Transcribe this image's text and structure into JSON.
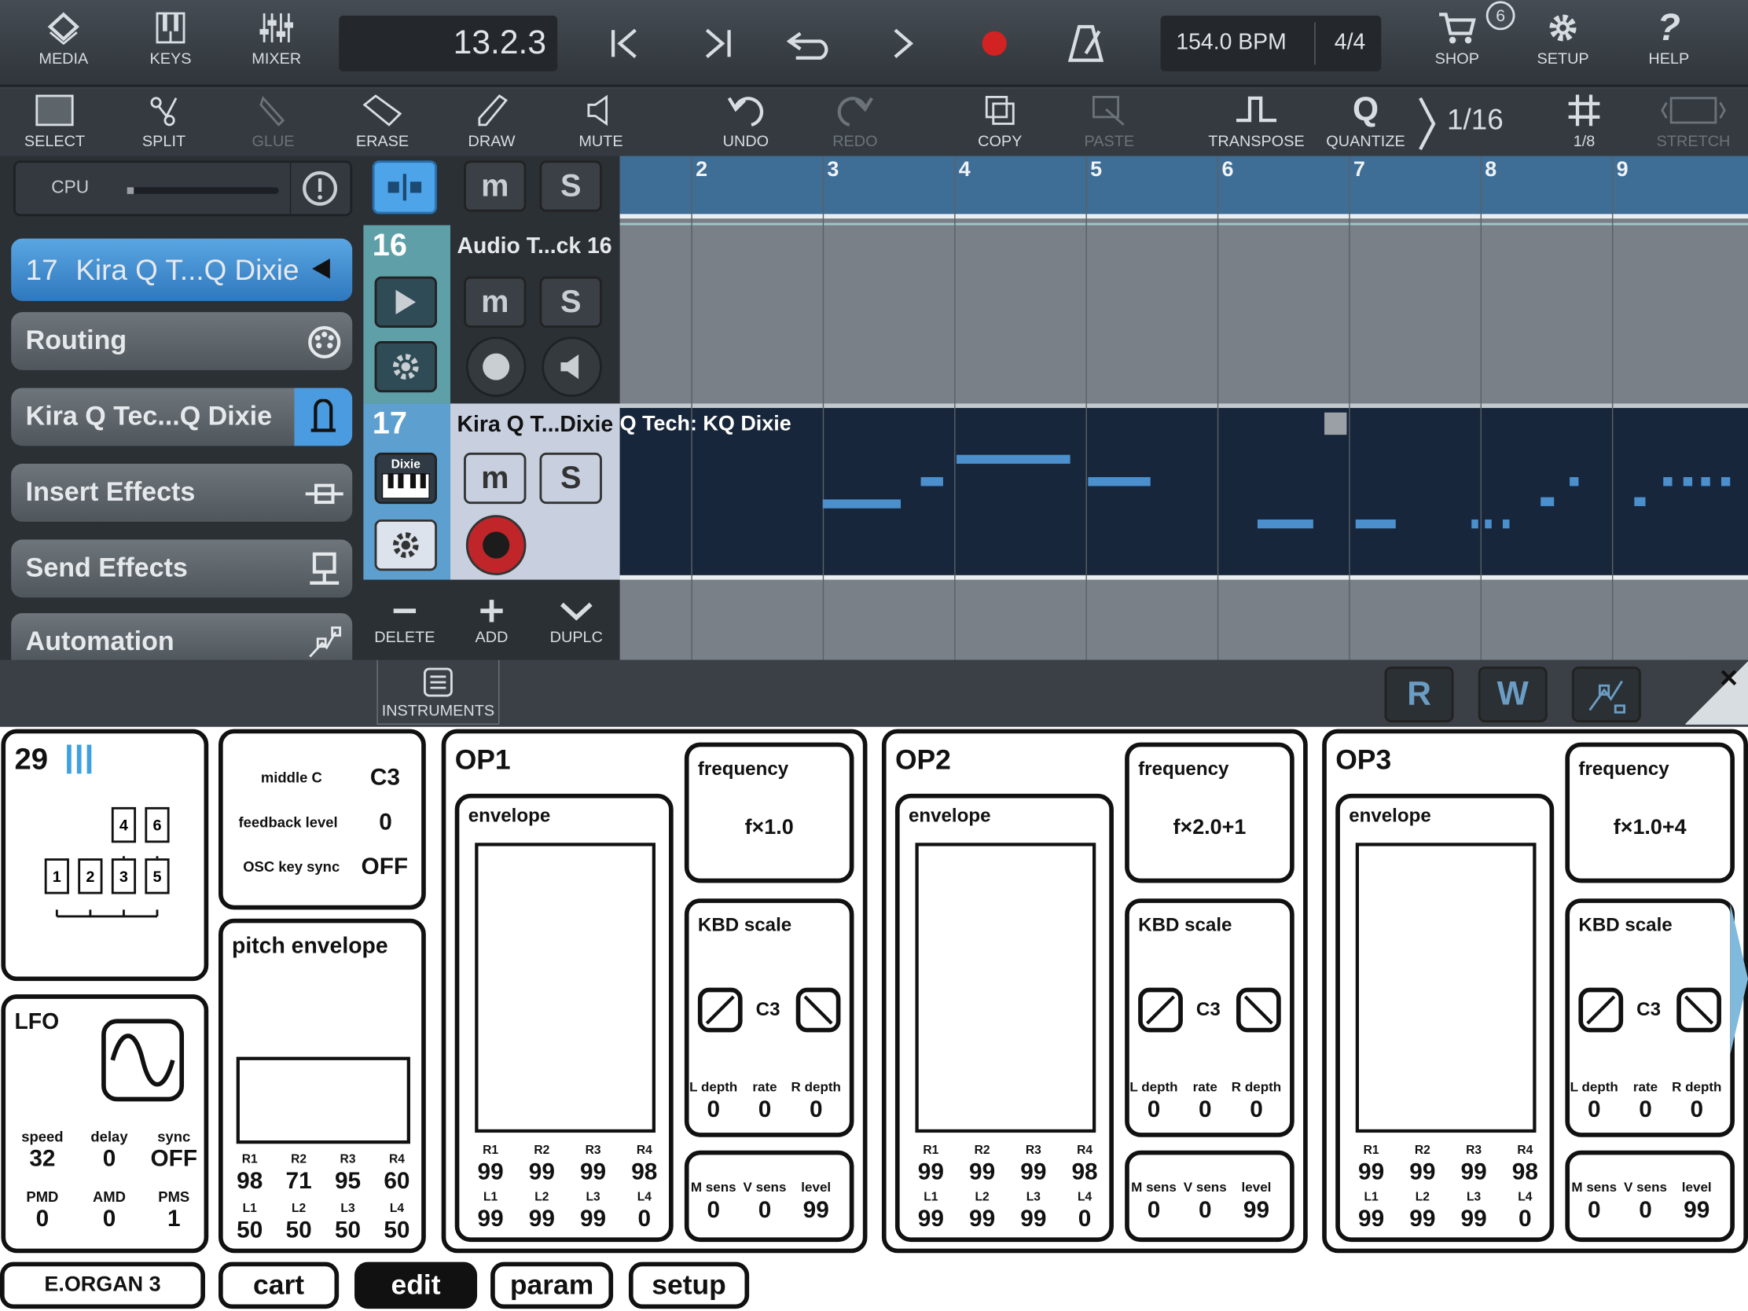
{
  "topbar": {
    "media": "MEDIA",
    "keys": "KEYS",
    "mixer": "MIXER",
    "position": "13.2.3",
    "tempo": "154.0 BPM",
    "signature": "4/4",
    "shop": "SHOP",
    "shop_badge": "6",
    "setup": "SETUP",
    "help": "HELP",
    "record_color": "#d32222"
  },
  "toolbar": {
    "select": "SELECT",
    "split": "SPLIT",
    "glue": "GLUE",
    "erase": "ERASE",
    "draw": "DRAW",
    "mute": "MUTE",
    "undo": "UNDO",
    "redo": "REDO",
    "copy": "COPY",
    "paste": "PASTE",
    "transpose": "TRANSPOSE",
    "quantize": "QUANTIZE",
    "quantize_value": "1/16",
    "grid_value": "1/8",
    "stretch": "STRETCH"
  },
  "left_panel": {
    "cpu_label": "CPU",
    "selected_track_number": "17",
    "selected_track_name": "Kira Q T...Q Dixie",
    "routing": "Routing",
    "instrument": "Kira Q Tec...Q Dixie",
    "insert_effects": "Insert Effects",
    "send_effects": "Send Effects",
    "automation": "Automation"
  },
  "tracks": [
    {
      "number": "16",
      "name": "Audio T...ck 16"
    },
    {
      "number": "17",
      "name": "Kira Q T...Dixie",
      "icon_text": "Dixie"
    }
  ],
  "track_actions": {
    "delete": "DELETE",
    "add": "ADD",
    "duplicate": "DUPLC"
  },
  "arrangement": {
    "ruler": [
      "2",
      "3",
      "4",
      "5",
      "6",
      "7",
      "8",
      "9"
    ],
    "clip_name": "Q Tech: KQ Dixie",
    "accent": "#4b8fcc"
  },
  "instrument_header": {
    "instruments": "INSTRUMENTS",
    "r": "R",
    "w": "W"
  },
  "synth": {
    "algorithm": "29",
    "algo_ops": [
      "1",
      "2",
      "3",
      "4",
      "5",
      "6"
    ],
    "middle_c_label": "middle C",
    "middle_c": "C3",
    "feedback_label": "feedback level",
    "feedback": "0",
    "osc_label": "OSC key sync",
    "osc": "OFF",
    "pitch_env_title": "pitch envelope",
    "pitch_rates": [
      {
        "k": "R1",
        "v": "98"
      },
      {
        "k": "R2",
        "v": "71"
      },
      {
        "k": "R3",
        "v": "95"
      },
      {
        "k": "R4",
        "v": "60"
      }
    ],
    "pitch_levels": [
      {
        "k": "L1",
        "v": "50"
      },
      {
        "k": "L2",
        "v": "50"
      },
      {
        "k": "L3",
        "v": "50"
      },
      {
        "k": "L4",
        "v": "50"
      }
    ],
    "lfo": {
      "title": "LFO",
      "speed_l": "speed",
      "speed": "32",
      "delay_l": "delay",
      "delay": "0",
      "sync_l": "sync",
      "sync": "OFF",
      "pmd_l": "PMD",
      "pmd": "0",
      "amd_l": "AMD",
      "amd": "0",
      "pms_l": "PMS",
      "pms": "1"
    },
    "ops": [
      {
        "title": "OP1",
        "env": "envelope",
        "freq_title": "frequency",
        "freq": "f×1.0",
        "kbd": "KBD scale",
        "note": "C3",
        "ld": "L depth",
        "rate": "rate",
        "rd": "R depth",
        "ldv": "0",
        "ratev": "0",
        "rdv": "0",
        "ms": "M sens",
        "vs": "V sens",
        "lvl": "level",
        "msv": "0",
        "vsv": "0",
        "lvlv": "99",
        "R1": "99",
        "R2": "99",
        "R3": "99",
        "R4": "98",
        "L1": "99",
        "L2": "99",
        "L3": "99",
        "L4": "0"
      },
      {
        "title": "OP2",
        "env": "envelope",
        "freq_title": "frequency",
        "freq": "f×2.0+1",
        "kbd": "KBD scale",
        "note": "C3",
        "ld": "L depth",
        "rate": "rate",
        "rd": "R depth",
        "ldv": "0",
        "ratev": "0",
        "rdv": "0",
        "ms": "M sens",
        "vs": "V sens",
        "lvl": "level",
        "msv": "0",
        "vsv": "0",
        "lvlv": "99",
        "R1": "99",
        "R2": "99",
        "R3": "99",
        "R4": "98",
        "L1": "99",
        "L2": "99",
        "L3": "99",
        "L4": "0"
      },
      {
        "title": "OP3",
        "env": "envelope",
        "freq_title": "frequency",
        "freq": "f×1.0+4",
        "kbd": "KBD scale",
        "note": "C3",
        "ld": "L depth",
        "rate": "rate",
        "rd": "R depth",
        "ldv": "0",
        "ratev": "0",
        "rdv": "0",
        "ms": "M sens",
        "vs": "V sens",
        "lvl": "level",
        "msv": "0",
        "vsv": "0",
        "lvlv": "99",
        "R1": "99",
        "R2": "99",
        "R3": "99",
        "R4": "98",
        "L1": "99",
        "L2": "99",
        "L3": "99",
        "L4": "0"
      }
    ],
    "patch": "E.ORGAN 3",
    "tabs": [
      "cart",
      "edit",
      "param",
      "setup"
    ]
  }
}
